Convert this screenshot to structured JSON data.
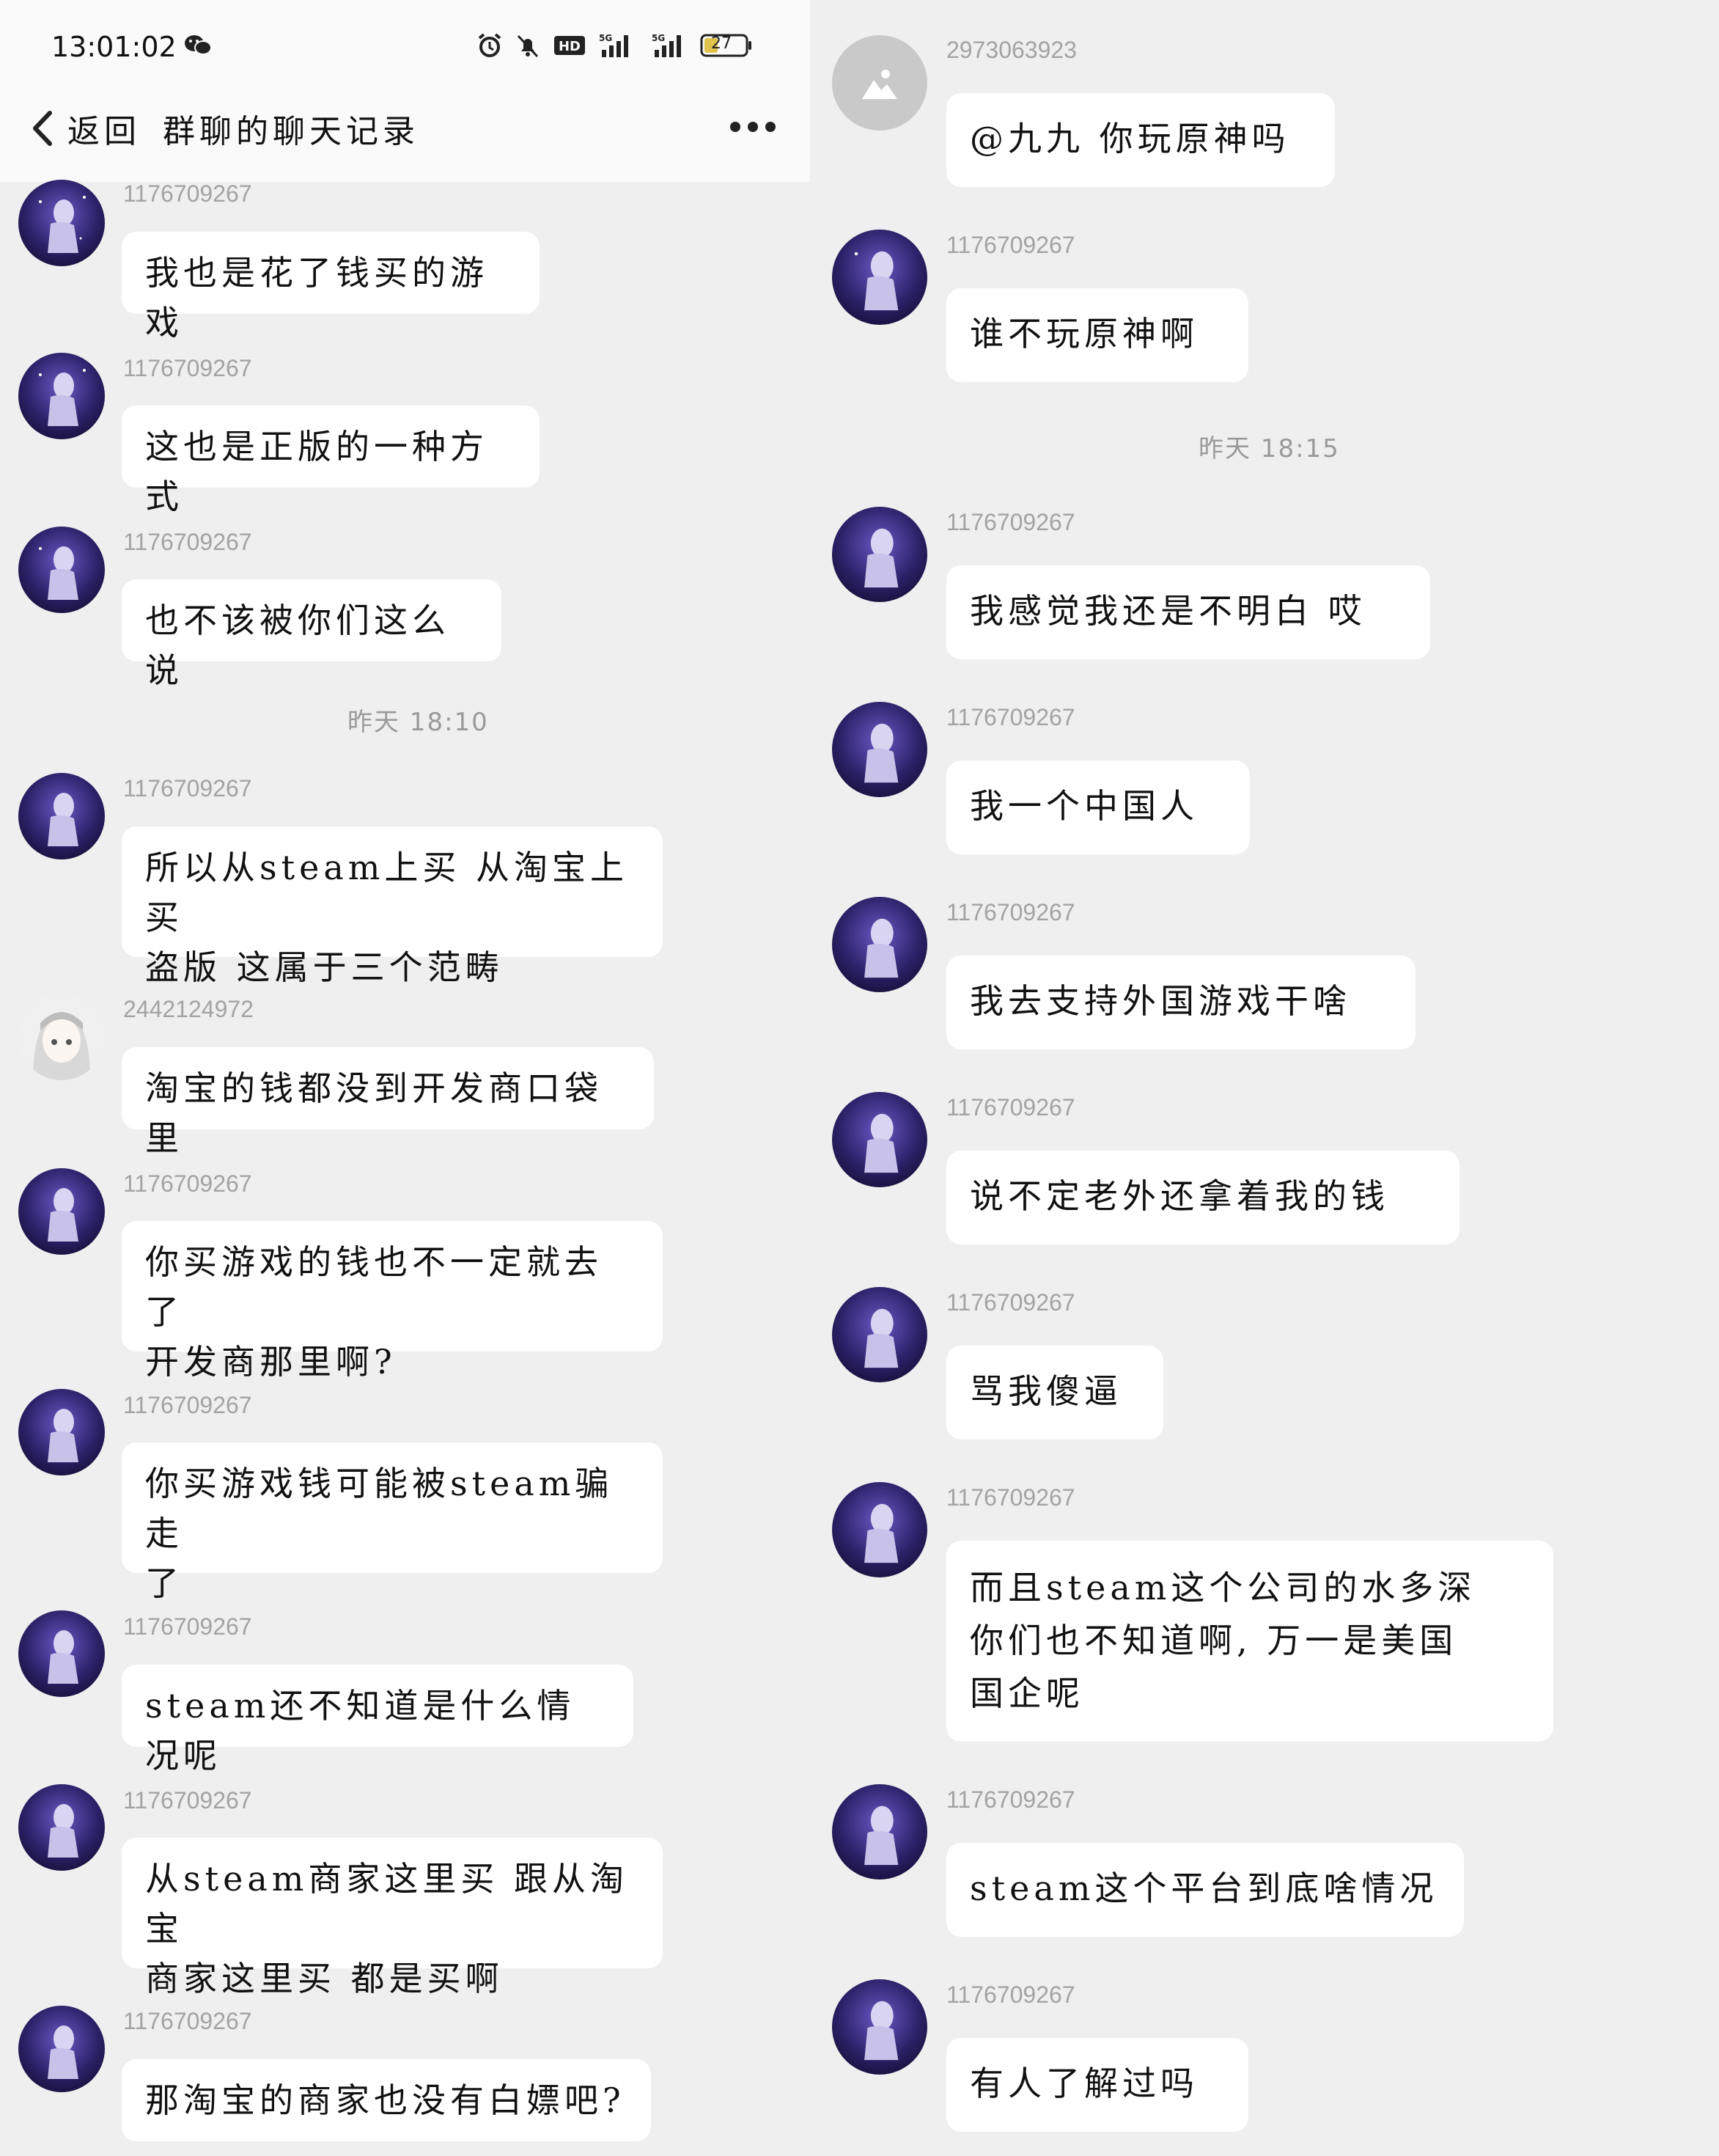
{
  "status_bar": {
    "time": "13:01:02",
    "battery": "27",
    "icons": [
      "wechat-icon",
      "alarm-icon",
      "mute-icon",
      "hd-icon",
      "signal-5g-icon",
      "signal-5g-icon",
      "battery-icon"
    ]
  },
  "nav": {
    "back_label": "返回",
    "title": "群聊的聊天记录",
    "more_icon": "more-dots-icon"
  },
  "left_messages": [
    {
      "uid": "1176709267",
      "text": "我也是花了钱买的游戏"
    },
    {
      "uid": "1176709267",
      "text": "这也是正版的一种方式"
    },
    {
      "uid": "1176709267",
      "text": "也不该被你们这么说"
    },
    {
      "divider": "昨天 18:10"
    },
    {
      "uid": "1176709267",
      "text": "所以从steam上买 从淘宝上买\n盗版 这属于三个范畴"
    },
    {
      "uid": "2442124972",
      "text": "淘宝的钱都没到开发商口袋里"
    },
    {
      "uid": "1176709267",
      "text": "你买游戏的钱也不一定就去了\n开发商那里啊?"
    },
    {
      "uid": "1176709267",
      "text": "你买游戏钱可能被steam骗走\n了"
    },
    {
      "uid": "1176709267",
      "text": "steam还不知道是什么情况呢"
    },
    {
      "uid": "1176709267",
      "text": "从steam商家这里买 跟从淘宝\n商家这里买 都是买啊"
    },
    {
      "uid": "1176709267",
      "text": "那淘宝的商家也没有白嫖吧?"
    }
  ],
  "right_messages": [
    {
      "uid": "2973063923",
      "text": "@九九 你玩原神吗"
    },
    {
      "uid": "1176709267",
      "text": "谁不玩原神啊"
    },
    {
      "divider": "昨天 18:15"
    },
    {
      "uid": "1176709267",
      "text": "我感觉我还是不明白 哎"
    },
    {
      "uid": "1176709267",
      "text": "我一个中国人"
    },
    {
      "uid": "1176709267",
      "text": "我去支持外国游戏干啥"
    },
    {
      "uid": "1176709267",
      "text": "说不定老外还拿着我的钱"
    },
    {
      "uid": "1176709267",
      "text": "骂我傻逼"
    },
    {
      "uid": "1176709267",
      "text": "而且steam这个公司的水多深\n你们也不知道啊, 万一是美国\n国企呢"
    },
    {
      "uid": "1176709267",
      "text": "steam这个平台到底啥情况"
    },
    {
      "uid": "1176709267",
      "text": "有人了解过吗"
    }
  ]
}
